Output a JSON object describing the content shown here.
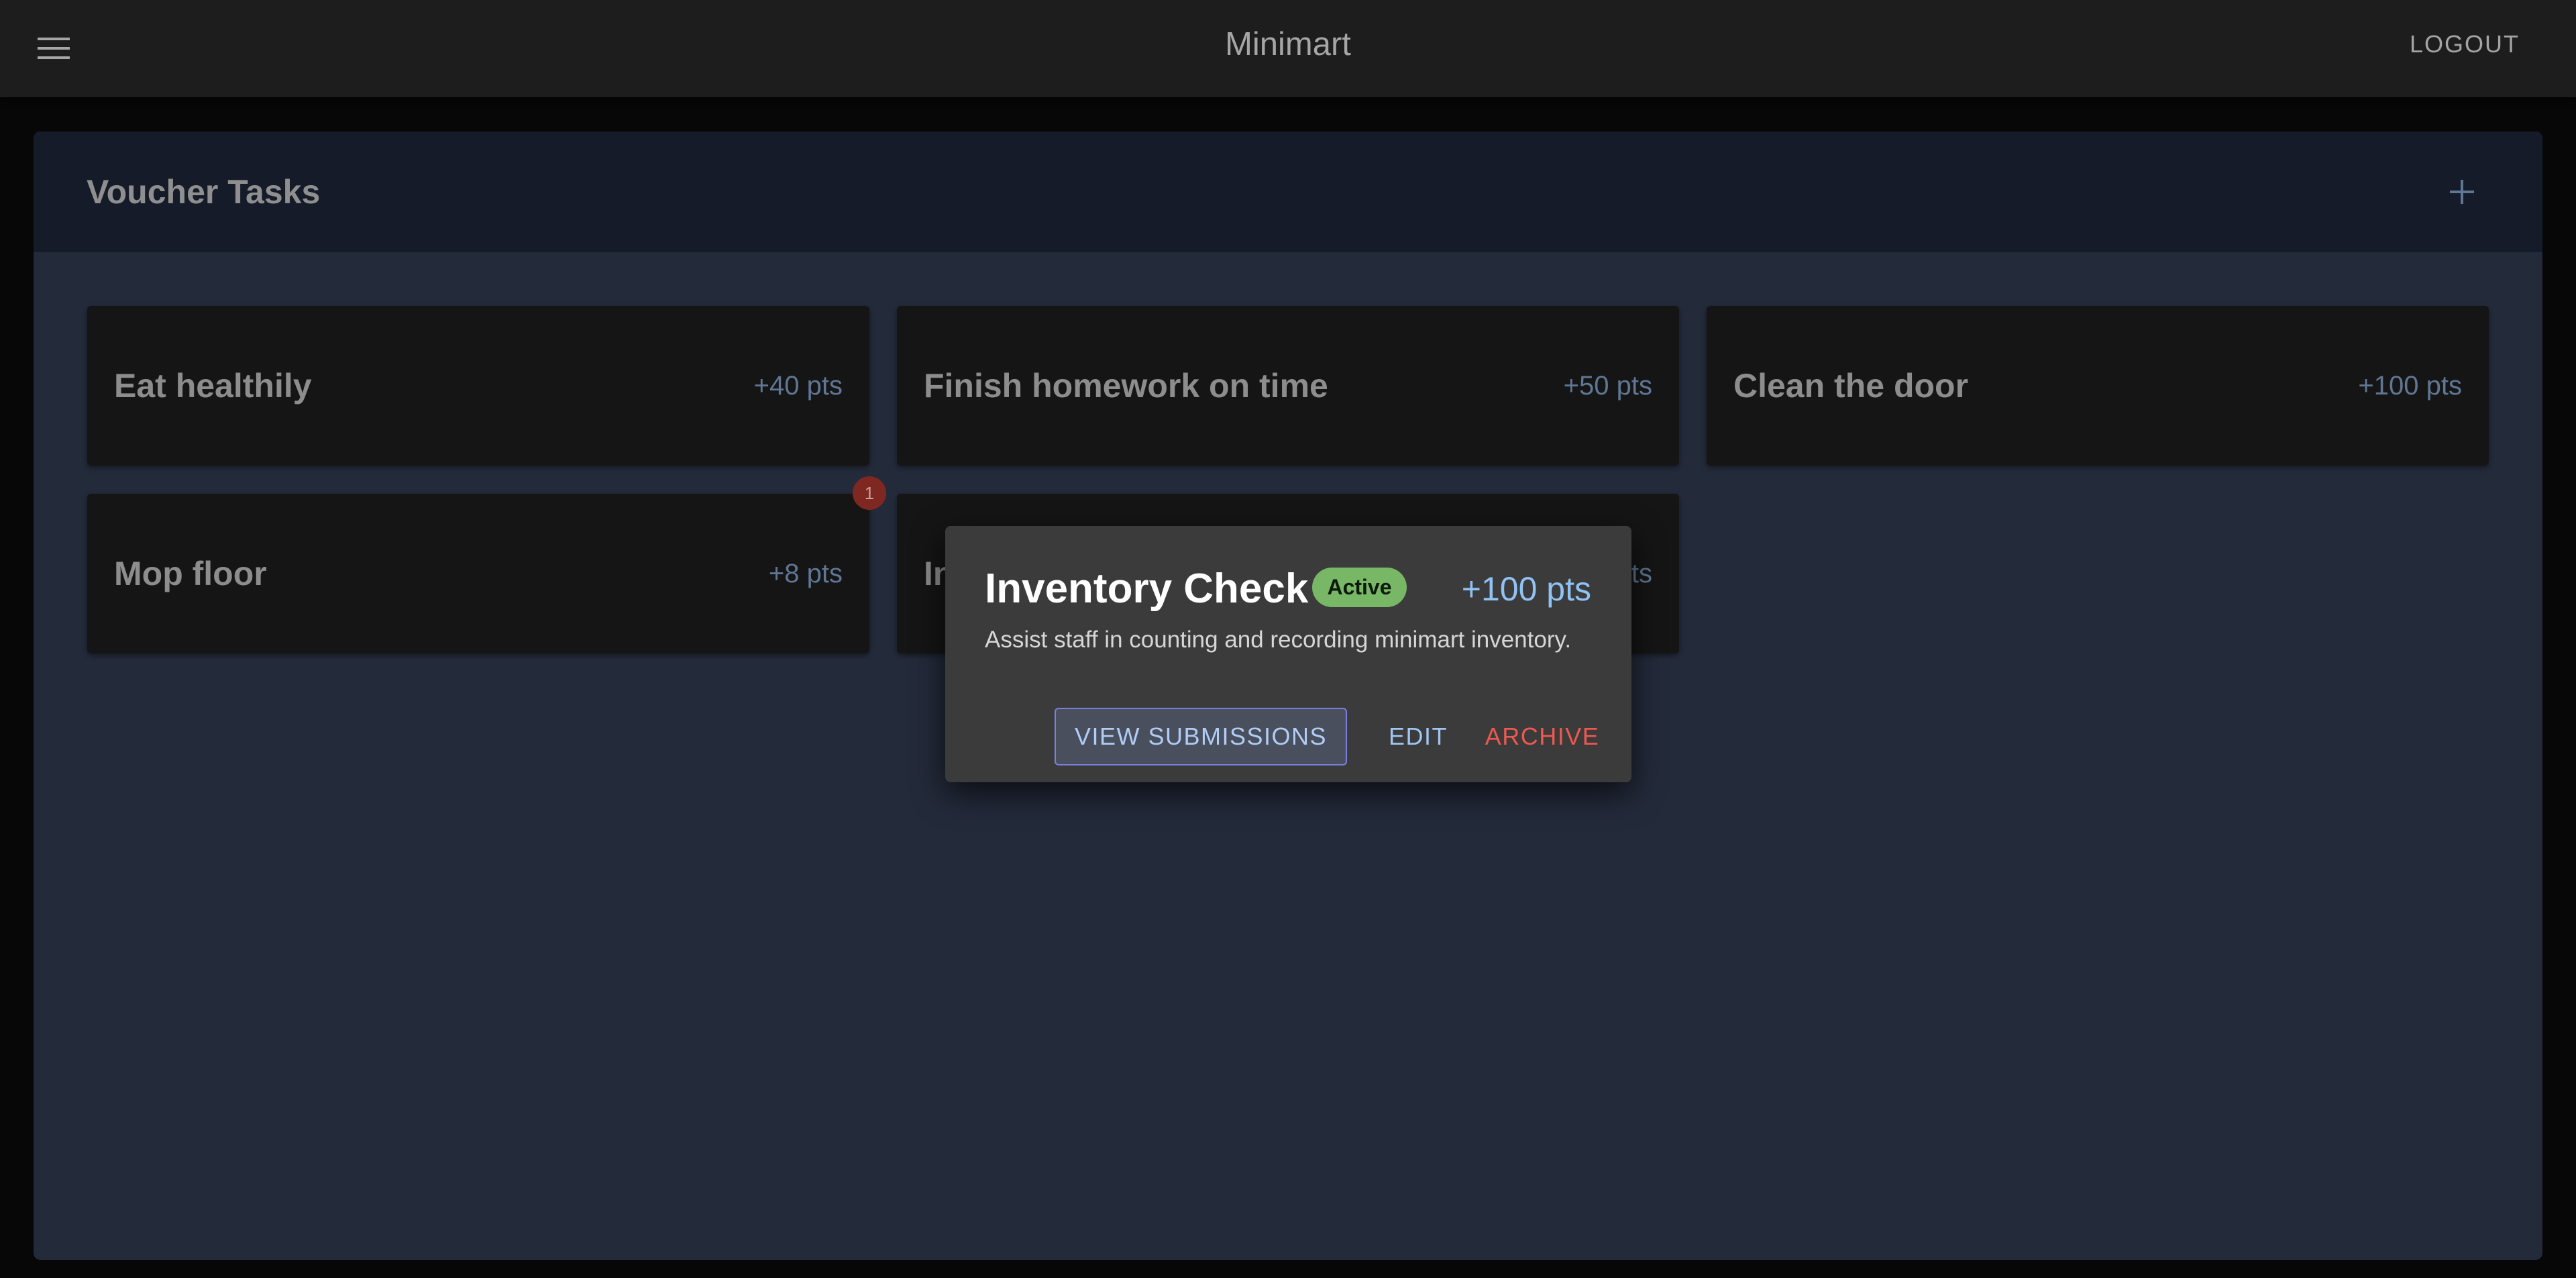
{
  "app": {
    "title": "Minimart",
    "menu_icon": "hamburger-menu-icon",
    "logout_label": "LOGOUT"
  },
  "panel": {
    "title": "Voucher Tasks",
    "add_icon": "plus-icon"
  },
  "tasks": [
    {
      "title": "Eat healthily",
      "points": "+40 pts"
    },
    {
      "title": "Finish homework on time",
      "points": "+50 pts"
    },
    {
      "title": "Clean the door",
      "points": "+100 pts"
    },
    {
      "title": "Mop floor",
      "points": "+8 pts"
    },
    {
      "title": "Inventory Check",
      "points": "+100 pts"
    }
  ],
  "notification_badge": "1",
  "dialog": {
    "title": "Inventory Check",
    "status": "Active",
    "points": "+100 pts",
    "description": "Assist staff in counting and recording minimart inventory.",
    "view_submissions_label": "VIEW SUBMISSIONS",
    "edit_label": "EDIT",
    "archive_label": "ARCHIVE"
  },
  "colors": {
    "accent": "#90c2f4",
    "status_active": "#78b766",
    "danger": "#ec5950",
    "badge": "#7f2822"
  }
}
